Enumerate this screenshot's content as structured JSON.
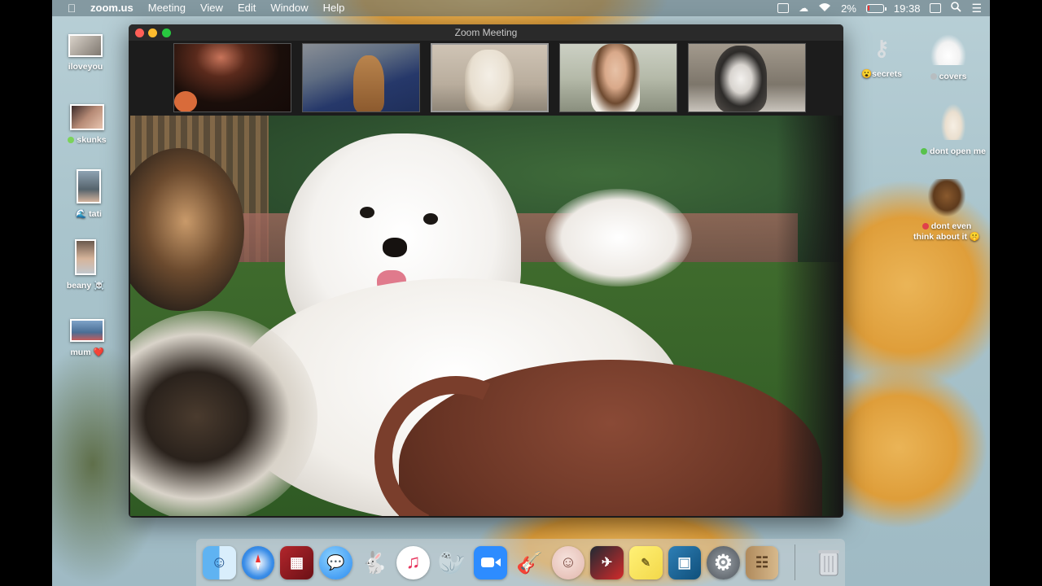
{
  "menubar": {
    "apple": "",
    "app": "zoom.us",
    "items": [
      "Meeting",
      "View",
      "Edit",
      "Window",
      "Help"
    ],
    "battery": "2%",
    "clock": "19:38"
  },
  "window": {
    "title": "Zoom Meeting"
  },
  "desktop_icons_left": [
    {
      "label": "iloveyou"
    },
    {
      "label": "skunks",
      "dot": "#7bd35a"
    },
    {
      "label": "tati",
      "prefix": "🌊"
    },
    {
      "label": "beany ☠️"
    },
    {
      "label": "mum ❤️"
    }
  ],
  "desktop_icons_right": [
    {
      "label": "secrets",
      "prefix": "😮"
    },
    {
      "label": "covers",
      "dot": "#b7bdc0"
    },
    {
      "label": "dont open me",
      "dot": "#58c24b"
    },
    {
      "label_line1": "dont even",
      "label_line2": "think about it 🤫",
      "dot": "#e0404a"
    }
  ],
  "dock": {
    "apps": [
      "finder",
      "safari",
      "photo-booth",
      "messages",
      "launchpad",
      "itunes",
      "seal-app",
      "zoom",
      "garageband",
      "face-app",
      "photo-app",
      "stickies",
      "preview",
      "system-preferences",
      "contacts"
    ],
    "trash": "trash"
  },
  "colors": {
    "zoom_blue": "#2d8cff",
    "close": "#ff5f57",
    "minimize": "#febc2e",
    "zoom_btn": "#28c840"
  }
}
